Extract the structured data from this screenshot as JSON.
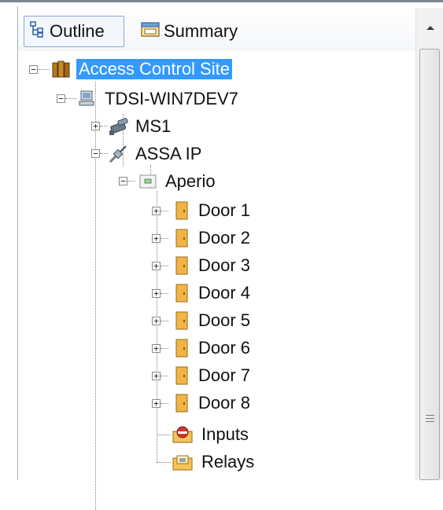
{
  "tabs": [
    {
      "label": "Outline",
      "icon": "tree-outline-icon",
      "active": true
    },
    {
      "label": "Summary",
      "icon": "summary-icon",
      "active": false
    }
  ],
  "tree": {
    "root": {
      "label": "Access Control Site",
      "icon": "books-icon",
      "expanded": true,
      "selected": true
    },
    "pc": {
      "label": "TDSI-WIN7DEV7",
      "icon": "computer-icon",
      "expanded": true
    },
    "ms1": {
      "label": "MS1",
      "icon": "network-icon",
      "expanded": false
    },
    "assa": {
      "label": "ASSA IP",
      "icon": "cable-icon",
      "expanded": true
    },
    "aperio": {
      "label": "Aperio",
      "icon": "panel-icon",
      "expanded": true
    },
    "doors": [
      {
        "label": "Door 1"
      },
      {
        "label": "Door 2"
      },
      {
        "label": "Door 3"
      },
      {
        "label": "Door 4"
      },
      {
        "label": "Door 5"
      },
      {
        "label": "Door 6"
      },
      {
        "label": "Door 7"
      },
      {
        "label": "Door 8"
      }
    ],
    "inputs": {
      "label": "Inputs",
      "icon": "inputs-folder-icon"
    },
    "relays": {
      "label": "Relays",
      "icon": "relays-folder-icon"
    }
  }
}
